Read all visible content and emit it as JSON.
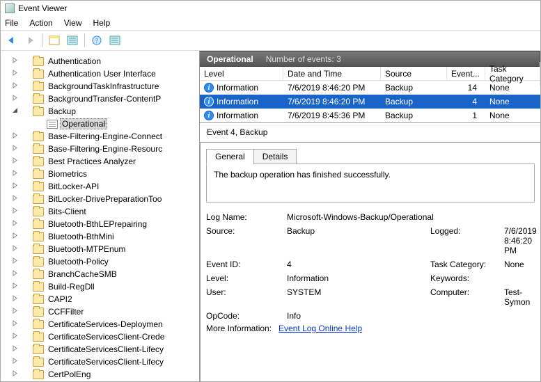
{
  "window": {
    "title": "Event Viewer"
  },
  "menu": {
    "file": "File",
    "action": "Action",
    "view": "View",
    "help": "Help"
  },
  "tree": {
    "items": [
      {
        "label": "Authentication",
        "exp": ">"
      },
      {
        "label": "Authentication User Interface",
        "exp": ">"
      },
      {
        "label": "BackgroundTaskInfrastructure",
        "exp": ">"
      },
      {
        "label": "BackgroundTransfer-ContentP",
        "exp": ">"
      },
      {
        "label": "Backup",
        "exp": "v",
        "expanded": true
      },
      {
        "label": "Operational",
        "child": true,
        "selected": true,
        "log": true
      },
      {
        "label": "Base-Filtering-Engine-Connect",
        "exp": ">"
      },
      {
        "label": "Base-Filtering-Engine-Resourc",
        "exp": ">"
      },
      {
        "label": "Best Practices Analyzer",
        "exp": ">"
      },
      {
        "label": "Biometrics",
        "exp": ">"
      },
      {
        "label": "BitLocker-API",
        "exp": ">"
      },
      {
        "label": "BitLocker-DrivePreparationToo",
        "exp": ">"
      },
      {
        "label": "Bits-Client",
        "exp": ">"
      },
      {
        "label": "Bluetooth-BthLEPrepairing",
        "exp": ">"
      },
      {
        "label": "Bluetooth-BthMini",
        "exp": ">"
      },
      {
        "label": "Bluetooth-MTPEnum",
        "exp": ">"
      },
      {
        "label": "Bluetooth-Policy",
        "exp": ">"
      },
      {
        "label": "BranchCacheSMB",
        "exp": ">"
      },
      {
        "label": "Build-RegDll",
        "exp": ">"
      },
      {
        "label": "CAPI2",
        "exp": ">"
      },
      {
        "label": "CCFFilter",
        "exp": ">"
      },
      {
        "label": "CertificateServices-Deploymen",
        "exp": ">"
      },
      {
        "label": "CertificateServicesClient-Crede",
        "exp": ">"
      },
      {
        "label": "CertificateServicesClient-Lifecy",
        "exp": ">"
      },
      {
        "label": "CertificateServicesClient-Lifecy",
        "exp": ">"
      },
      {
        "label": "CertPolEng",
        "exp": ">"
      }
    ]
  },
  "right": {
    "title": "Operational",
    "count_label": "Number of events: 3"
  },
  "grid": {
    "headers": {
      "level": "Level",
      "date": "Date and Time",
      "source": "Source",
      "eid": "Event...",
      "tc": "Task Category"
    },
    "rows": [
      {
        "level": "Information",
        "date": "7/6/2019 8:46:20 PM",
        "source": "Backup",
        "eid": "14",
        "tc": "None"
      },
      {
        "level": "Information",
        "date": "7/6/2019 8:46:20 PM",
        "source": "Backup",
        "eid": "4",
        "tc": "None",
        "selected": true
      },
      {
        "level": "Information",
        "date": "7/6/2019 8:45:36 PM",
        "source": "Backup",
        "eid": "1",
        "tc": "None"
      }
    ]
  },
  "detail": {
    "heading": "Event 4, Backup",
    "tabs": {
      "general": "General",
      "details": "Details"
    },
    "message": "The backup operation has finished successfully.",
    "props": {
      "logname_k": "Log Name:",
      "logname_v": "Microsoft-Windows-Backup/Operational",
      "source_k": "Source:",
      "source_v": "Backup",
      "logged_k": "Logged:",
      "logged_v": "7/6/2019 8:46:20 PM",
      "eid_k": "Event ID:",
      "eid_v": "4",
      "tc_k": "Task Category:",
      "tc_v": "None",
      "level_k": "Level:",
      "level_v": "Information",
      "kw_k": "Keywords:",
      "kw_v": "",
      "user_k": "User:",
      "user_v": "SYSTEM",
      "comp_k": "Computer:",
      "comp_v": "Test-Symon",
      "op_k": "OpCode:",
      "op_v": "Info",
      "more_k": "More Information:",
      "more_link": "Event Log Online Help"
    }
  }
}
